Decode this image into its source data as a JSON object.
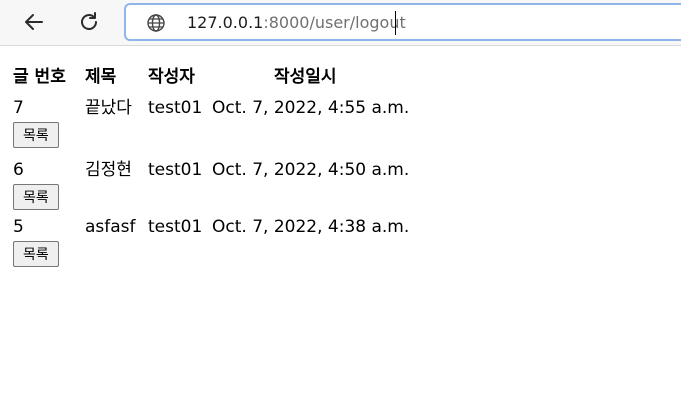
{
  "browser": {
    "url_host": "127.0.0.1",
    "url_path": ":8000/user/logout",
    "icons": {
      "back": "back-arrow-icon",
      "reload": "reload-icon",
      "site": "globe-icon"
    }
  },
  "table": {
    "headers": [
      "글 번호",
      "제목",
      "작성자",
      "작성일시"
    ],
    "rows": [
      {
        "no": "7",
        "title": "끝났다",
        "author": "test01",
        "date": "Oct. 7, 2022, 4:55 a.m.",
        "button": "목록"
      },
      {
        "no": "6",
        "title": "김정현",
        "author": "test01",
        "date": "Oct. 7, 2022, 4:50 a.m.",
        "button": "목록"
      },
      {
        "no": "5",
        "title": "asfasf",
        "author": "test01",
        "date": "Oct. 7, 2022, 4:38 a.m.",
        "button": "목록"
      }
    ]
  }
}
